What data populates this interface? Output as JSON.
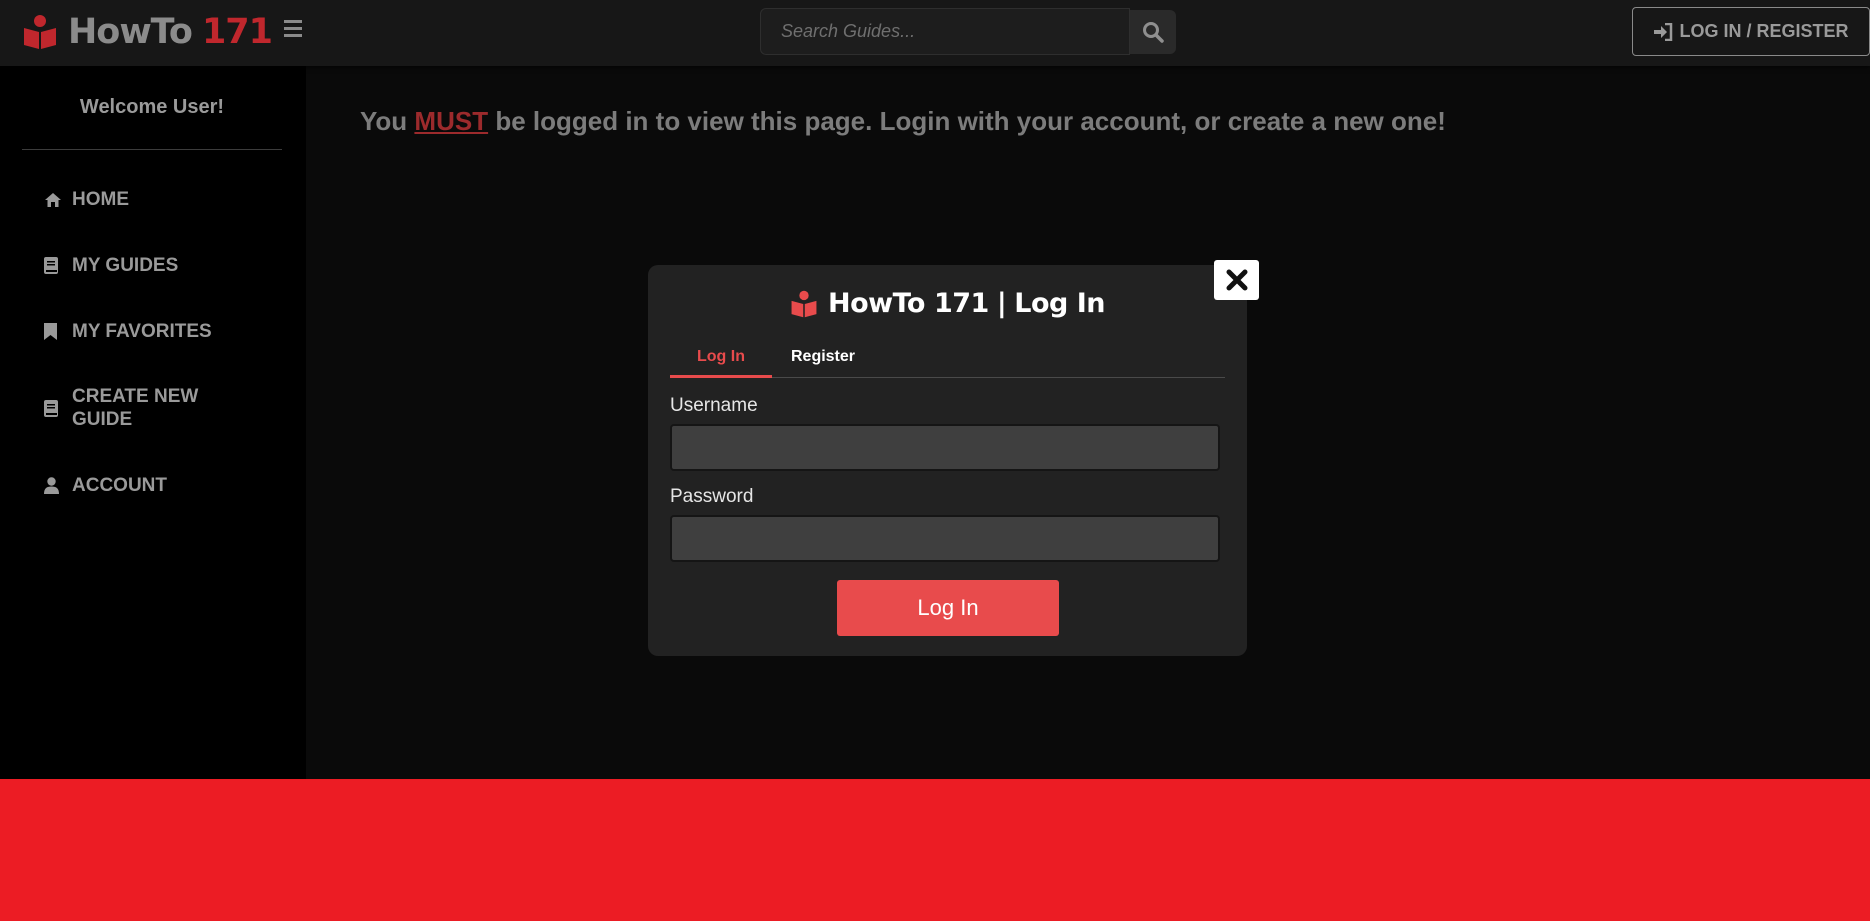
{
  "brand": {
    "name": "HowTo",
    "number": "171",
    "icon": "book-reader-icon",
    "number_color": "#c0272d"
  },
  "header": {
    "menu_icon": "hamburger-icon",
    "search": {
      "placeholder": "Search Guides...",
      "value": "",
      "icon": "search-icon"
    },
    "login_button": {
      "label": "LOG IN / REGISTER",
      "icon": "sign-in-icon"
    }
  },
  "sidebar": {
    "welcome": "Welcome User!",
    "items": [
      {
        "label": "HOME",
        "icon": "home-icon"
      },
      {
        "label": "MY GUIDES",
        "icon": "book-icon"
      },
      {
        "label": "MY FAVORITES",
        "icon": "bookmark-icon"
      },
      {
        "label": "CREATE NEW",
        "label2": "GUIDE",
        "icon": "book-icon"
      },
      {
        "label": "ACCOUNT",
        "icon": "user-icon"
      }
    ]
  },
  "main": {
    "notice_pre": "You",
    "notice_must": "MUST",
    "notice_post": "be logged in to view this page. Login with your account, or create a new one!"
  },
  "modal": {
    "title_brand": "HowTo",
    "title_number": "171",
    "title_separator": "|",
    "title_suffix": "Log In",
    "close_icon": "close-icon",
    "tabs": [
      {
        "label": "Log In",
        "active": true
      },
      {
        "label": "Register",
        "active": false
      }
    ],
    "username": {
      "label": "Username",
      "value": ""
    },
    "password": {
      "label": "Password",
      "value": ""
    },
    "submit_label": "Log In",
    "accent_color": "#e84b4c"
  },
  "colors": {
    "footer": "#ec1c24",
    "background": "#0a0a0a",
    "sidebar": "#000000"
  }
}
